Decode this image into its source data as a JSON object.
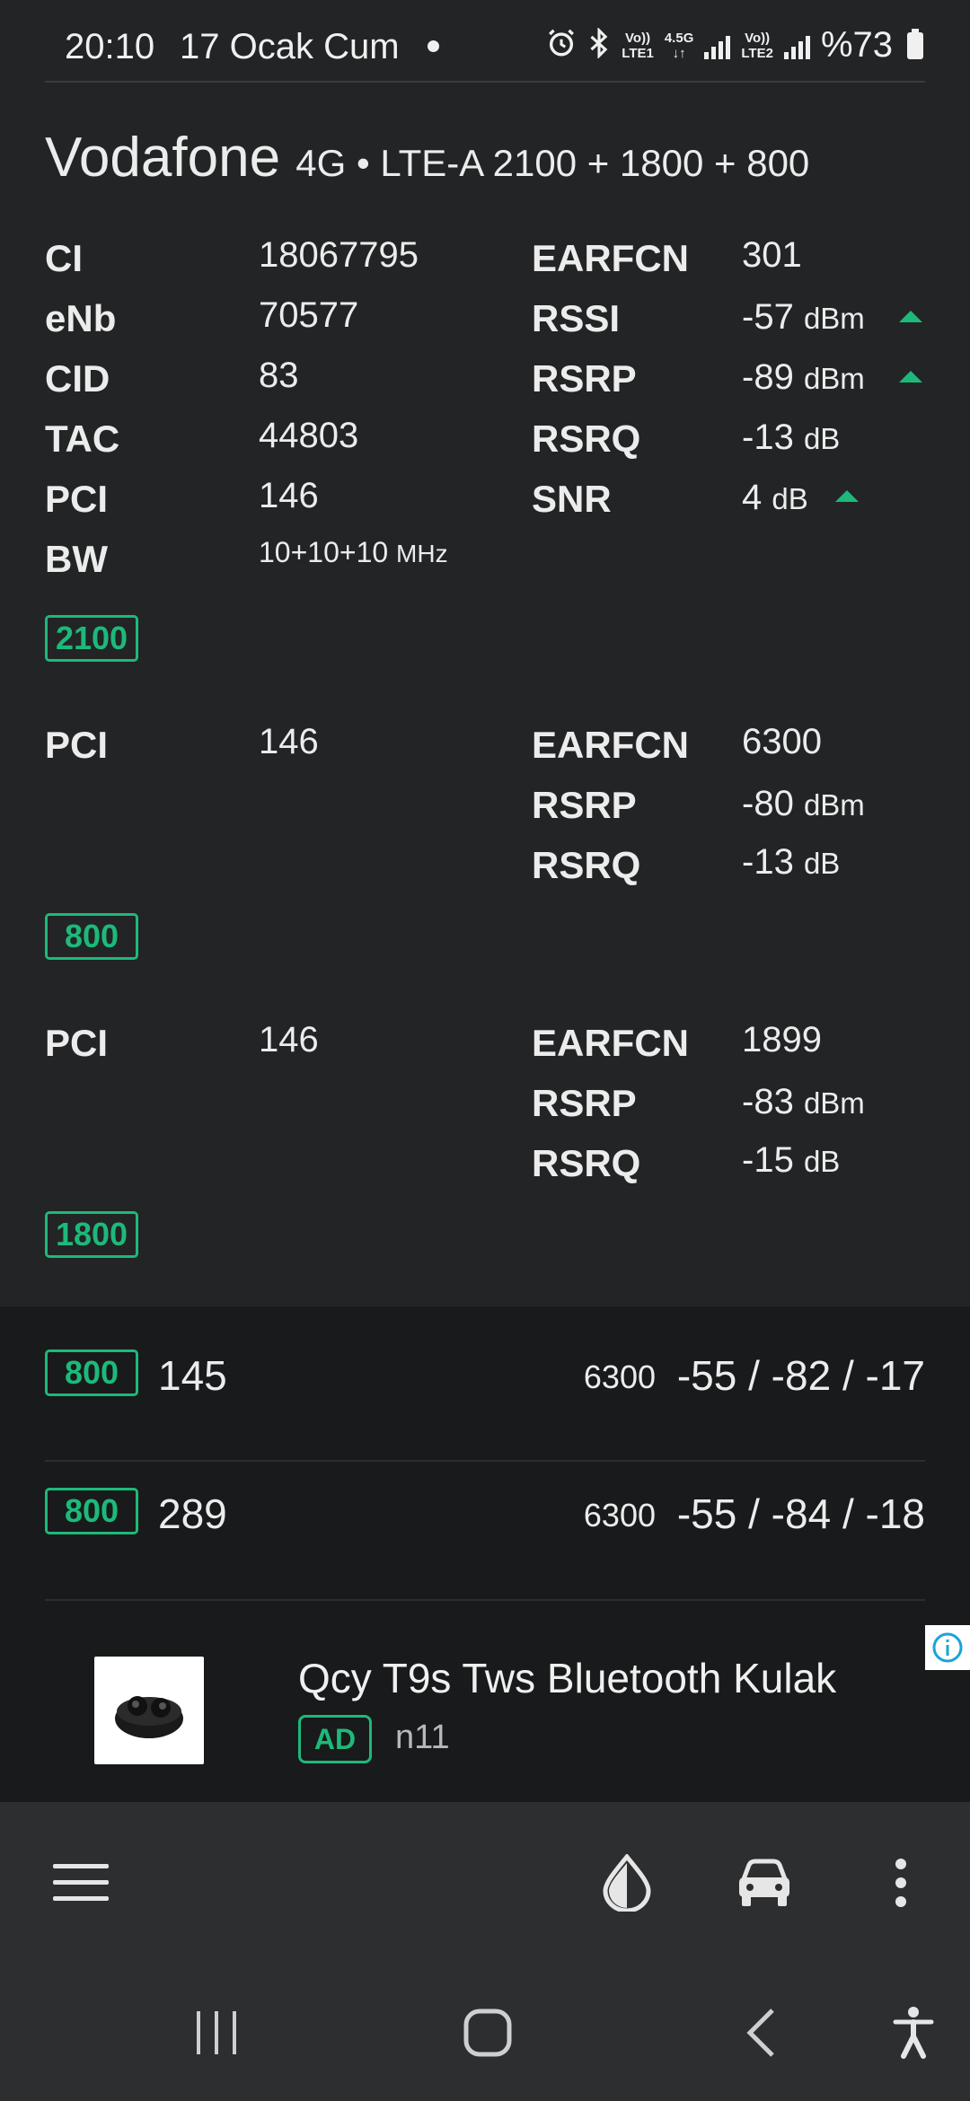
{
  "status_bar": {
    "time": "20:10",
    "date": "17 Ocak Cum",
    "sim1": {
      "top": "Vo))",
      "bottom": "LTE1"
    },
    "net": {
      "top": "4.5G",
      "bottom": "↓↑"
    },
    "sim2": {
      "top": "Vo))",
      "bottom": "LTE2"
    },
    "battery": "%73"
  },
  "header": {
    "operator": "Vodafone",
    "tech": "4G • LTE-A 2100 + 1800 + 800"
  },
  "primary": {
    "left": [
      {
        "label": "CI",
        "value": "18067795"
      },
      {
        "label": "eNb",
        "value": "70577"
      },
      {
        "label": "CID",
        "value": "83"
      },
      {
        "label": "TAC",
        "value": "44803"
      },
      {
        "label": "PCI",
        "value": "146"
      },
      {
        "label": "BW",
        "value": "10+10+10",
        "unit": "MHz"
      }
    ],
    "right": [
      {
        "label": "EARFCN",
        "value": "301"
      },
      {
        "label": "RSSI",
        "value": "-57",
        "unit": "dBm"
      },
      {
        "label": "RSRP",
        "value": "-89",
        "unit": "dBm"
      },
      {
        "label": "RSRQ",
        "value": "-13",
        "unit": "dB"
      },
      {
        "label": "SNR",
        "value": "4",
        "unit": "dB"
      }
    ],
    "band": "2100"
  },
  "carrier2": {
    "pci_label": "PCI",
    "pci": "146",
    "earfcn_label": "EARFCN",
    "earfcn": "6300",
    "rsrp_label": "RSRP",
    "rsrp": "-80",
    "rsrp_unit": "dBm",
    "rsrq_label": "RSRQ",
    "rsrq": "-13",
    "rsrq_unit": "dB",
    "band": "800"
  },
  "carrier3": {
    "pci_label": "PCI",
    "pci": "146",
    "earfcn_label": "EARFCN",
    "earfcn": "1899",
    "rsrp_label": "RSRP",
    "rsrp": "-83",
    "rsrp_unit": "dBm",
    "rsrq_label": "RSRQ",
    "rsrq": "-15",
    "rsrq_unit": "dB",
    "band": "1800"
  },
  "neighbors": [
    {
      "band": "800",
      "pci": "145",
      "earfcn": "6300",
      "signal": "-55 / -82 / -17"
    },
    {
      "band": "800",
      "pci": "289",
      "earfcn": "6300",
      "signal": "-55 / -84 / -18"
    }
  ],
  "ad": {
    "title": "Qcy T9s Tws Bluetooth Kulak",
    "badge": "AD",
    "source": "n11"
  },
  "colors": {
    "background": "#222425",
    "neighbors_bg": "#191a1b",
    "accent_green": "#1db97a",
    "toolbar_bg": "#2c2e30"
  },
  "icons": [
    "menu-icon",
    "theme-drop-icon",
    "car-icon",
    "more-vert-icon",
    "recents-icon",
    "home-icon",
    "back-icon",
    "accessibility-icon",
    "alarm-icon",
    "bluetooth-icon",
    "ad-info-icon"
  ]
}
